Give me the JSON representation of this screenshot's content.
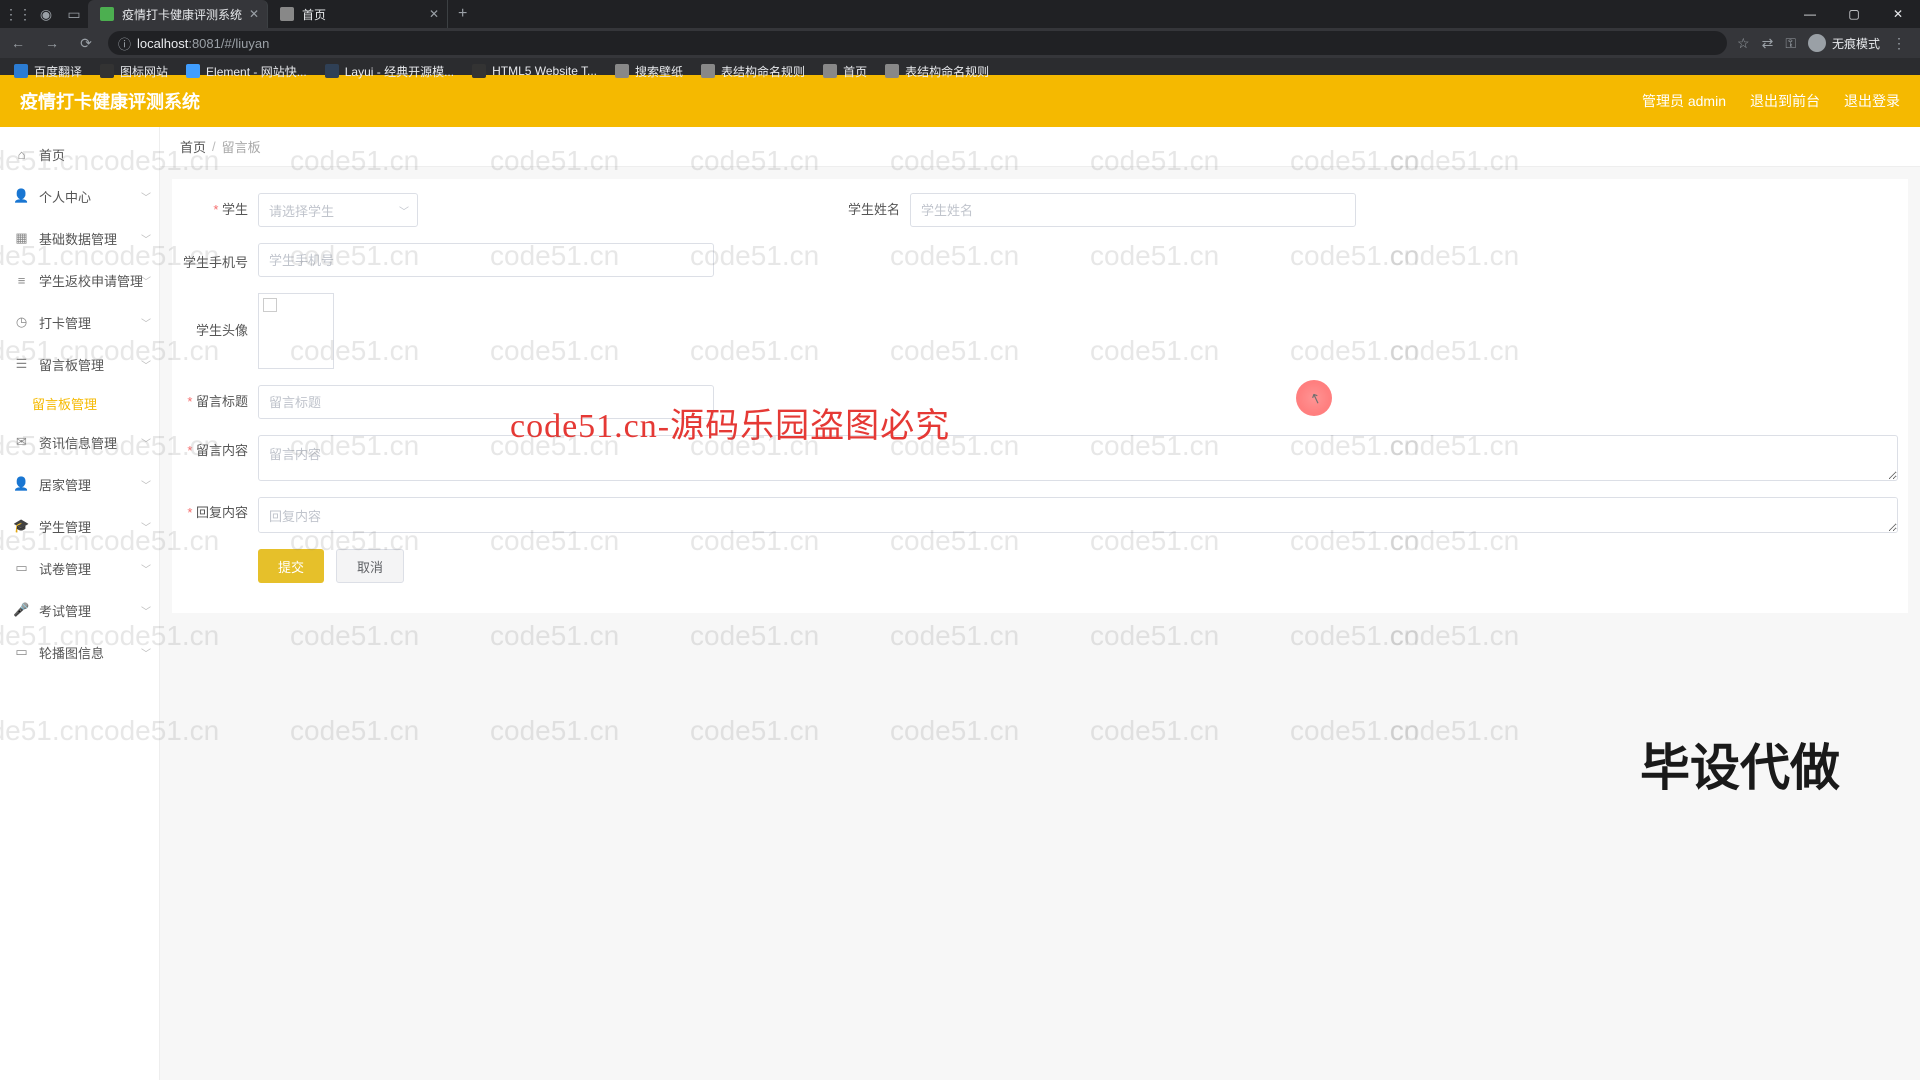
{
  "browser": {
    "tabs": [
      {
        "title": "疫情打卡健康评测系统",
        "favicon_color": "#4caf50",
        "active": true
      },
      {
        "title": "首页",
        "favicon_color": "#888",
        "active": false
      }
    ],
    "url_host_prefix": "localhost",
    "url_host_port": ":8081",
    "url_path": "/#/liuyan",
    "incognito_label": "无痕模式",
    "bookmarks": [
      {
        "label": "百度翻译",
        "color": "#2b7cd3"
      },
      {
        "label": "图标网站",
        "color": "#333"
      },
      {
        "label": "Element - 网站快...",
        "color": "#409eff"
      },
      {
        "label": "Layui - 经典开源模...",
        "color": "#2f4056"
      },
      {
        "label": "HTML5 Website T...",
        "color": "#333"
      },
      {
        "label": "搜索壁纸",
        "color": "#888"
      },
      {
        "label": "表结构命名规则",
        "color": "#888"
      },
      {
        "label": "首页",
        "color": "#888"
      },
      {
        "label": "表结构命名规则",
        "color": "#888"
      }
    ]
  },
  "app": {
    "title": "疫情打卡健康评测系统",
    "header_right": {
      "admin_prefix": "管理员",
      "admin_name": "admin",
      "exit_front": "退出到前台",
      "logout": "退出登录"
    }
  },
  "sidebar": {
    "items": [
      {
        "label": "首页",
        "icon": "home"
      },
      {
        "label": "个人中心",
        "icon": "user",
        "expandable": true
      },
      {
        "label": "基础数据管理",
        "icon": "grid",
        "expandable": true
      },
      {
        "label": "学生返校申请管理",
        "icon": "bars",
        "expandable": true
      },
      {
        "label": "打卡管理",
        "icon": "clock",
        "expandable": true
      },
      {
        "label": "留言板管理",
        "icon": "list",
        "expandable": true,
        "expanded": true,
        "children": [
          {
            "label": "留言板管理",
            "active": true
          }
        ]
      },
      {
        "label": "资讯信息管理",
        "icon": "news",
        "expandable": true
      },
      {
        "label": "居家管理",
        "icon": "user",
        "expandable": true
      },
      {
        "label": "学生管理",
        "icon": "school",
        "expandable": true
      },
      {
        "label": "试卷管理",
        "icon": "doc",
        "expandable": true
      },
      {
        "label": "考试管理",
        "icon": "mic",
        "expandable": true
      },
      {
        "label": "轮播图信息",
        "icon": "image",
        "expandable": true
      }
    ]
  },
  "breadcrumb": {
    "home": "首页",
    "current": "留言板"
  },
  "form": {
    "student_label": "学生",
    "student_placeholder": "请选择学生",
    "student_name_label": "学生姓名",
    "student_name_placeholder": "学生姓名",
    "student_phone_label": "学生手机号",
    "student_phone_placeholder": "学生手机号",
    "avatar_label": "学生头像",
    "title_label": "留言标题",
    "title_placeholder": "留言标题",
    "content_label": "留言内容",
    "content_placeholder": "留言内容",
    "reply_label": "回复内容",
    "reply_placeholder": "回复内容",
    "submit_label": "提交",
    "cancel_label": "取消"
  },
  "watermark": {
    "repeat_text": "code51.cn",
    "center_text": "code51.cn-源码乐园盗图必究",
    "corner_text": "毕设代做"
  },
  "colors": {
    "accent": "#f5b900",
    "btn_primary": "#e6c02a",
    "sidebar_active": "#f5b900",
    "required": "#f56c6c"
  }
}
